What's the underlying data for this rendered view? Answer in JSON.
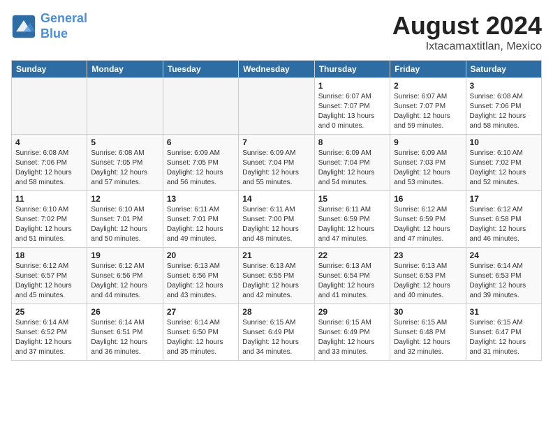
{
  "header": {
    "logo_line1": "General",
    "logo_line2": "Blue",
    "month_year": "August 2024",
    "location": "Ixtacamaxtitlan, Mexico"
  },
  "weekdays": [
    "Sunday",
    "Monday",
    "Tuesday",
    "Wednesday",
    "Thursday",
    "Friday",
    "Saturday"
  ],
  "weeks": [
    [
      {
        "day": "",
        "info": ""
      },
      {
        "day": "",
        "info": ""
      },
      {
        "day": "",
        "info": ""
      },
      {
        "day": "",
        "info": ""
      },
      {
        "day": "1",
        "info": "Sunrise: 6:07 AM\nSunset: 7:07 PM\nDaylight: 13 hours\nand 0 minutes."
      },
      {
        "day": "2",
        "info": "Sunrise: 6:07 AM\nSunset: 7:07 PM\nDaylight: 12 hours\nand 59 minutes."
      },
      {
        "day": "3",
        "info": "Sunrise: 6:08 AM\nSunset: 7:06 PM\nDaylight: 12 hours\nand 58 minutes."
      }
    ],
    [
      {
        "day": "4",
        "info": "Sunrise: 6:08 AM\nSunset: 7:06 PM\nDaylight: 12 hours\nand 58 minutes."
      },
      {
        "day": "5",
        "info": "Sunrise: 6:08 AM\nSunset: 7:05 PM\nDaylight: 12 hours\nand 57 minutes."
      },
      {
        "day": "6",
        "info": "Sunrise: 6:09 AM\nSunset: 7:05 PM\nDaylight: 12 hours\nand 56 minutes."
      },
      {
        "day": "7",
        "info": "Sunrise: 6:09 AM\nSunset: 7:04 PM\nDaylight: 12 hours\nand 55 minutes."
      },
      {
        "day": "8",
        "info": "Sunrise: 6:09 AM\nSunset: 7:04 PM\nDaylight: 12 hours\nand 54 minutes."
      },
      {
        "day": "9",
        "info": "Sunrise: 6:09 AM\nSunset: 7:03 PM\nDaylight: 12 hours\nand 53 minutes."
      },
      {
        "day": "10",
        "info": "Sunrise: 6:10 AM\nSunset: 7:02 PM\nDaylight: 12 hours\nand 52 minutes."
      }
    ],
    [
      {
        "day": "11",
        "info": "Sunrise: 6:10 AM\nSunset: 7:02 PM\nDaylight: 12 hours\nand 51 minutes."
      },
      {
        "day": "12",
        "info": "Sunrise: 6:10 AM\nSunset: 7:01 PM\nDaylight: 12 hours\nand 50 minutes."
      },
      {
        "day": "13",
        "info": "Sunrise: 6:11 AM\nSunset: 7:01 PM\nDaylight: 12 hours\nand 49 minutes."
      },
      {
        "day": "14",
        "info": "Sunrise: 6:11 AM\nSunset: 7:00 PM\nDaylight: 12 hours\nand 48 minutes."
      },
      {
        "day": "15",
        "info": "Sunrise: 6:11 AM\nSunset: 6:59 PM\nDaylight: 12 hours\nand 47 minutes."
      },
      {
        "day": "16",
        "info": "Sunrise: 6:12 AM\nSunset: 6:59 PM\nDaylight: 12 hours\nand 47 minutes."
      },
      {
        "day": "17",
        "info": "Sunrise: 6:12 AM\nSunset: 6:58 PM\nDaylight: 12 hours\nand 46 minutes."
      }
    ],
    [
      {
        "day": "18",
        "info": "Sunrise: 6:12 AM\nSunset: 6:57 PM\nDaylight: 12 hours\nand 45 minutes."
      },
      {
        "day": "19",
        "info": "Sunrise: 6:12 AM\nSunset: 6:56 PM\nDaylight: 12 hours\nand 44 minutes."
      },
      {
        "day": "20",
        "info": "Sunrise: 6:13 AM\nSunset: 6:56 PM\nDaylight: 12 hours\nand 43 minutes."
      },
      {
        "day": "21",
        "info": "Sunrise: 6:13 AM\nSunset: 6:55 PM\nDaylight: 12 hours\nand 42 minutes."
      },
      {
        "day": "22",
        "info": "Sunrise: 6:13 AM\nSunset: 6:54 PM\nDaylight: 12 hours\nand 41 minutes."
      },
      {
        "day": "23",
        "info": "Sunrise: 6:13 AM\nSunset: 6:53 PM\nDaylight: 12 hours\nand 40 minutes."
      },
      {
        "day": "24",
        "info": "Sunrise: 6:14 AM\nSunset: 6:53 PM\nDaylight: 12 hours\nand 39 minutes."
      }
    ],
    [
      {
        "day": "25",
        "info": "Sunrise: 6:14 AM\nSunset: 6:52 PM\nDaylight: 12 hours\nand 37 minutes."
      },
      {
        "day": "26",
        "info": "Sunrise: 6:14 AM\nSunset: 6:51 PM\nDaylight: 12 hours\nand 36 minutes."
      },
      {
        "day": "27",
        "info": "Sunrise: 6:14 AM\nSunset: 6:50 PM\nDaylight: 12 hours\nand 35 minutes."
      },
      {
        "day": "28",
        "info": "Sunrise: 6:15 AM\nSunset: 6:49 PM\nDaylight: 12 hours\nand 34 minutes."
      },
      {
        "day": "29",
        "info": "Sunrise: 6:15 AM\nSunset: 6:49 PM\nDaylight: 12 hours\nand 33 minutes."
      },
      {
        "day": "30",
        "info": "Sunrise: 6:15 AM\nSunset: 6:48 PM\nDaylight: 12 hours\nand 32 minutes."
      },
      {
        "day": "31",
        "info": "Sunrise: 6:15 AM\nSunset: 6:47 PM\nDaylight: 12 hours\nand 31 minutes."
      }
    ]
  ]
}
